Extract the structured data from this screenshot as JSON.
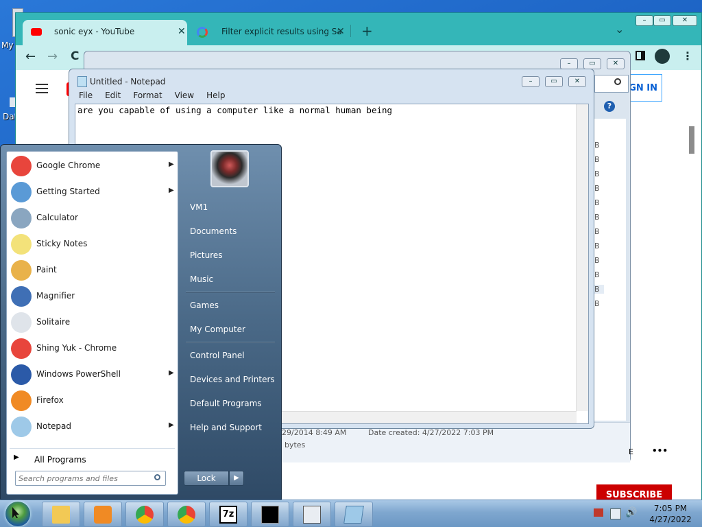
{
  "desktop": {
    "icons": [
      {
        "label": "My"
      },
      {
        "label": "Dat"
      }
    ]
  },
  "chrome": {
    "tabs": [
      {
        "title": "sonic eyx - YouTube",
        "icon": "youtube-icon",
        "active": true
      },
      {
        "title": "Filter explicit results using SafeSe",
        "icon": "google-icon",
        "active": false
      }
    ],
    "new_tab": "+",
    "tab_list": "⌄",
    "window_controls": {
      "minimize": "–",
      "maximize": "▭",
      "close": "✕"
    },
    "nav": {
      "back": "←",
      "forward": "→",
      "reload": "C"
    },
    "menu_icon": "⋮",
    "youtube": {
      "signin_label": "SIGN IN",
      "subscribe_label": "SUBSCRIBE",
      "more_label": "•••"
    }
  },
  "explorer": {
    "size_letters": [
      "B",
      "B",
      "B",
      "B",
      "B",
      "B",
      "B",
      "B",
      "B",
      "B",
      "B",
      "B"
    ],
    "date_modified_partial": "29/2014 8:49 AM",
    "date_created": "Date created: 4/27/2022 7:03 PM",
    "size_partial": "bytes",
    "e_partial": "E"
  },
  "notepad": {
    "title": "Untitled - Notepad",
    "menu": [
      "File",
      "Edit",
      "Format",
      "View",
      "Help"
    ],
    "content": "are you capable of using a computer like a normal human being"
  },
  "start_menu": {
    "programs": [
      {
        "label": "Google Chrome",
        "icon": "chrome-icon",
        "submenu": true,
        "color": "#e8453c"
      },
      {
        "label": "Getting Started",
        "icon": "getting-started-icon",
        "submenu": true,
        "color": "#5a9ad6"
      },
      {
        "label": "Calculator",
        "icon": "calculator-icon",
        "submenu": false,
        "color": "#8aa6c0"
      },
      {
        "label": "Sticky Notes",
        "icon": "sticky-notes-icon",
        "submenu": false,
        "color": "#f3e27a"
      },
      {
        "label": "Paint",
        "icon": "paint-icon",
        "submenu": false,
        "color": "#e9b24a"
      },
      {
        "label": "Magnifier",
        "icon": "magnifier-icon",
        "submenu": false,
        "color": "#3f6fb5"
      },
      {
        "label": "Solitaire",
        "icon": "solitaire-icon",
        "submenu": false,
        "color": "#dfe4ea"
      },
      {
        "label": "Shing Yuk - Chrome",
        "icon": "chrome-profile-icon",
        "submenu": false,
        "color": "#e8453c"
      },
      {
        "label": "Windows PowerShell",
        "icon": "powershell-icon",
        "submenu": true,
        "color": "#2b5aa8"
      },
      {
        "label": "Firefox",
        "icon": "firefox-icon",
        "submenu": false,
        "color": "#f08a24"
      },
      {
        "label": "Notepad",
        "icon": "notepad-icon",
        "submenu": true,
        "color": "#9ec9e8"
      }
    ],
    "all_programs": "All Programs",
    "search_placeholder": "Search programs and files",
    "right_items": [
      "VM1",
      "Documents",
      "Pictures",
      "Music",
      "Games",
      "My Computer",
      "Control Panel",
      "Devices and Printers",
      "Default Programs",
      "Help and Support"
    ],
    "lock_label": "Lock",
    "lock_arrow": "▶"
  },
  "taskbar": {
    "items": [
      {
        "icon": "explorer-icon"
      },
      {
        "icon": "media-player-icon"
      },
      {
        "icon": "chrome-icon"
      },
      {
        "icon": "chrome-profile-icon"
      },
      {
        "icon": "7zip-icon",
        "text": "7z"
      },
      {
        "icon": "cmd-icon"
      },
      {
        "icon": "calculator-icon"
      },
      {
        "icon": "notepad-icon"
      }
    ],
    "time": "7:05 PM",
    "date": "4/27/2022"
  }
}
